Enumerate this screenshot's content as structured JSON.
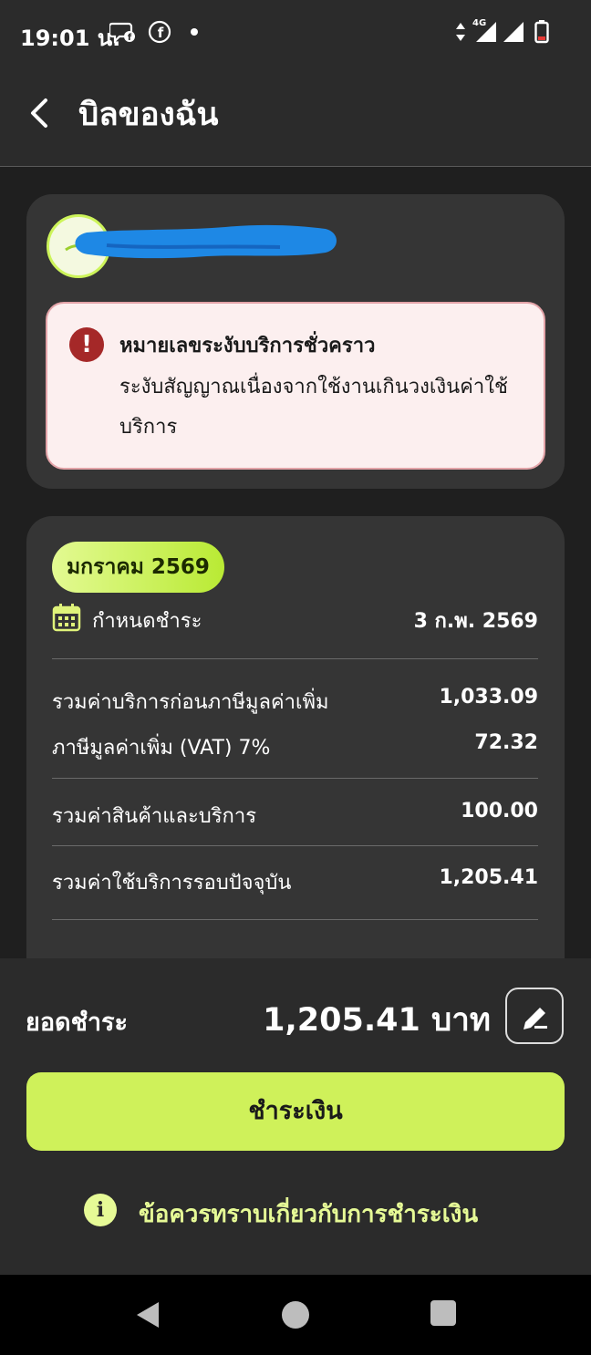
{
  "status_bar": {
    "time": "19:01 น.",
    "network": "4G"
  },
  "header": {
    "title": "บิลของฉัน"
  },
  "account_alert": {
    "title": "หมายเลขระงับบริการชั่วคราว",
    "body": "ระงับสัญญาณเนื่องจากใช้งานเกินวงเงินค่าใช้บริการ"
  },
  "bill": {
    "month_badge": "มกราคม 2569",
    "due_label": "กำหนดชำระ",
    "due_date": "3 ก.พ. 2569",
    "rows": [
      {
        "label": "รวมค่าบริการก่อนภาษีมูลค่าเพิ่ม",
        "value": "1,033.09"
      },
      {
        "label": "ภาษีมูลค่าเพิ่ม (VAT) 7%",
        "value": "72.32"
      },
      {
        "label": "รวมค่าสินค้าและบริการ",
        "value": "100.00"
      },
      {
        "label": "รวมค่าใช้บริการรอบปัจจุบัน",
        "value": "1,205.41"
      }
    ]
  },
  "payment": {
    "total_label": "ยอดชำระ",
    "total_amount": "1,205.41 บาท",
    "pay_button": "ชำระเงิน",
    "info_link": "ข้อควรทราบเกี่ยวกับการชำระเงิน"
  },
  "colors": {
    "accent": "#cff15a",
    "alert_bg": "#fcefef",
    "alert_icon": "#a52828",
    "background": "#2b2b2b",
    "card": "#353535"
  },
  "icons": [
    "back-arrow-icon",
    "error-icon",
    "calendar-icon",
    "edit-icon",
    "info-icon",
    "nav-back-icon",
    "nav-home-icon",
    "nav-recents-icon"
  ]
}
